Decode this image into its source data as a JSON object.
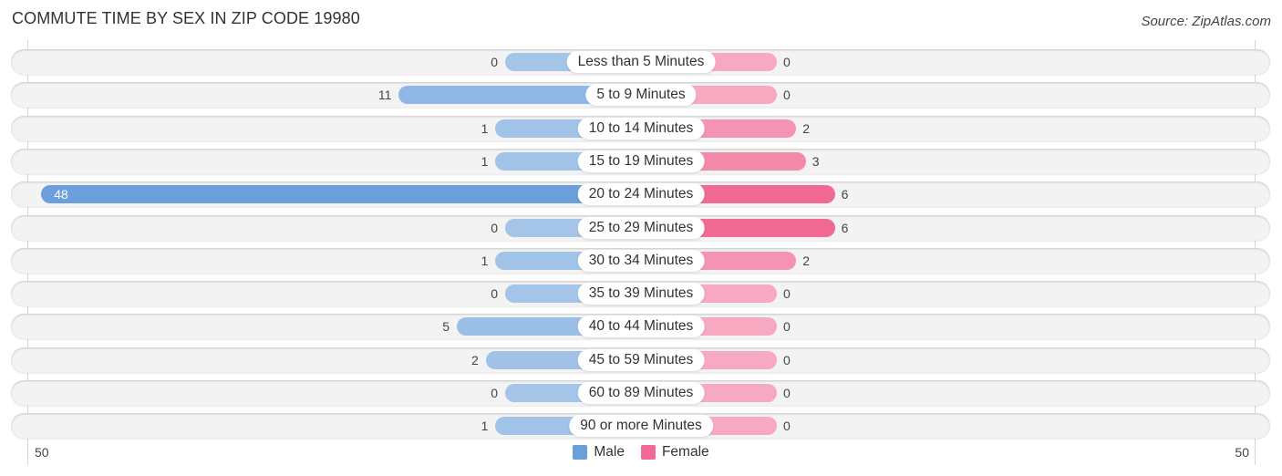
{
  "chart_data": {
    "type": "bar",
    "orientation": "diverging-horizontal",
    "title": "COMMUTE TIME BY SEX IN ZIP CODE 19980",
    "source": "Source: ZipAtlas.com",
    "categories": [
      "Less than 5 Minutes",
      "5 to 9 Minutes",
      "10 to 14 Minutes",
      "15 to 19 Minutes",
      "20 to 24 Minutes",
      "25 to 29 Minutes",
      "30 to 34 Minutes",
      "35 to 39 Minutes",
      "40 to 44 Minutes",
      "45 to 59 Minutes",
      "60 to 89 Minutes",
      "90 or more Minutes"
    ],
    "series": [
      {
        "name": "Male",
        "color": "#6a9fdb",
        "light_color": "#a4c4e8",
        "values": [
          0,
          11,
          1,
          1,
          48,
          0,
          1,
          0,
          5,
          2,
          0,
          1
        ]
      },
      {
        "name": "Female",
        "color": "#f06a93",
        "light_color": "#f6a9c1",
        "values": [
          0,
          0,
          2,
          3,
          6,
          6,
          2,
          0,
          0,
          0,
          0,
          0
        ]
      }
    ],
    "axis": {
      "left_label": "50",
      "right_label": "50",
      "range": [
        -50,
        50
      ]
    },
    "legend": {
      "position": "bottom-center",
      "items": [
        {
          "label": "Male",
          "color": "#6a9fdb"
        },
        {
          "label": "Female",
          "color": "#f06a93"
        }
      ]
    },
    "grid": false
  }
}
